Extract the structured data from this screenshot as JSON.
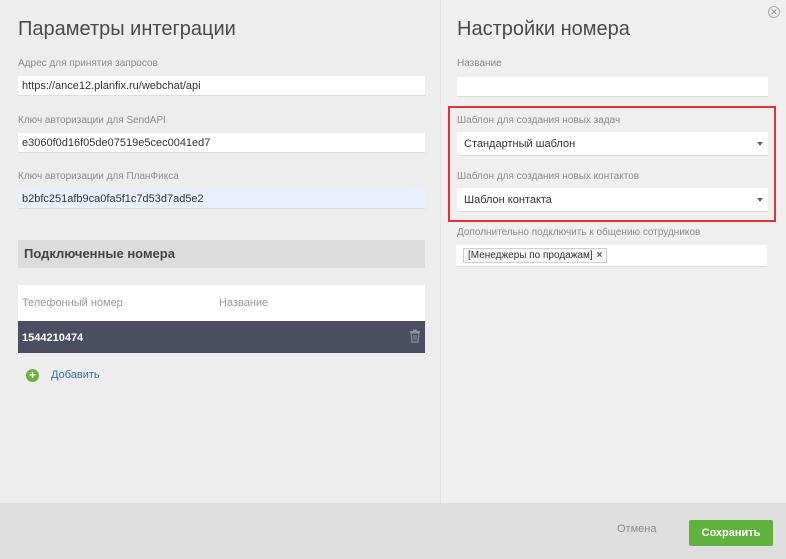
{
  "integration": {
    "title": "Параметры интеграции",
    "url_label": "Адрес для принятия запросов",
    "url_value": "https://ance12.planfix.ru/webchat/api",
    "sendapi_label": "Ключ авторизации для SendAPI",
    "sendapi_value": "e3060f0d16f05de07519e5cec0041ed7",
    "planfix_label": "Ключ авторизации для ПланФикса",
    "planfix_value": "b2bfc251afb9ca0fa5f1c7d53d7ad5e2"
  },
  "numbers": {
    "section_title": "Подключенные номера",
    "columns": [
      "Телефонный номер",
      "Название"
    ],
    "rows": [
      {
        "phone": "1544210474",
        "name": ""
      }
    ],
    "add_label": "Добавить"
  },
  "settings": {
    "title": "Настройки номера",
    "name_label": "Название",
    "name_value": "",
    "task_template_label": "Шаблон для создания новых задач",
    "task_template_value": "Стандартный шаблон",
    "contact_template_label": "Шаблон для создания новых контактов",
    "contact_template_value": "Шаблон контакта",
    "extra_label": "Дополнительно подключить к общению сотрудников",
    "extra_tags": [
      "[Менеджеры по продажам]"
    ]
  },
  "footer": {
    "cancel_label": "Отмена",
    "save_label": "Сохранить"
  },
  "colors": {
    "accent": "#5fb33c",
    "highlight": "#e0323a",
    "selected_row": "#4b4e60"
  }
}
